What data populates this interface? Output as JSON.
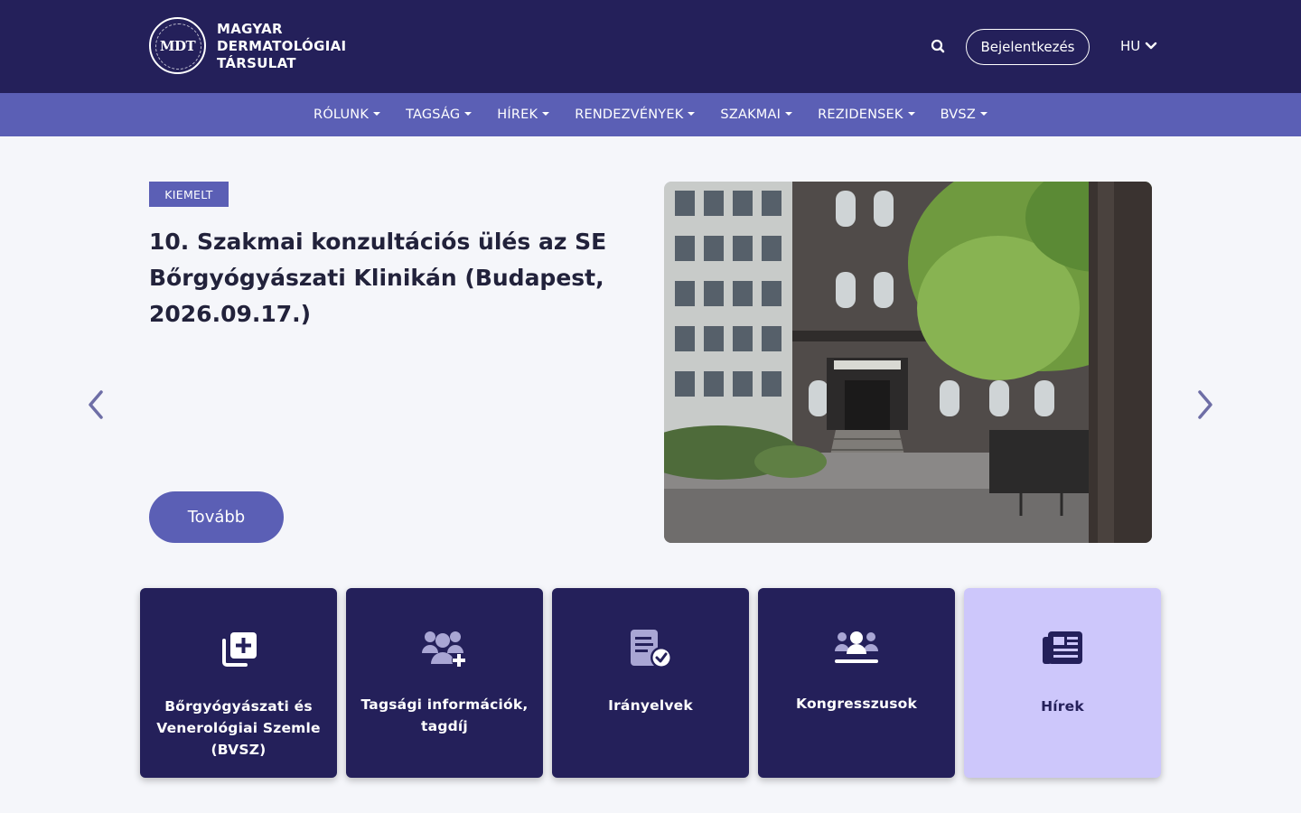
{
  "header": {
    "logo_mark": "MDT",
    "logo_lines": [
      "MAGYAR",
      "DERMATOLÓGIAI",
      "TÁRSULAT"
    ],
    "login_label": "Bejelentkezés",
    "language": "HU"
  },
  "nav": {
    "items": [
      "RÓLUNK",
      "TAGSÁG",
      "HÍREK",
      "RENDEZVÉNYEK",
      "SZAKMAI",
      "REZIDENSEK",
      "BVSZ"
    ]
  },
  "hero": {
    "badge": "KIEMELT",
    "title": "10. Szakmai konzultációs ülés az SE Bőrgyógyászati Klinikán (Budapest, 2026.09.17.)",
    "button_label": "Tovább"
  },
  "cards": [
    {
      "label": "Bőrgyógyászati és Venerológiai Szemle (BVSZ)",
      "icon": "journal-plus-icon"
    },
    {
      "label": "Tagsági információk, tagdíj",
      "icon": "users-plus-icon"
    },
    {
      "label": "Irányelvek",
      "icon": "document-check-icon"
    },
    {
      "label": "Kongresszusok",
      "icon": "people-group-icon"
    },
    {
      "label": "Hírek",
      "icon": "newspaper-icon"
    }
  ],
  "colors": {
    "header_bg": "#24205a",
    "nav_bg": "#5b5fb5",
    "accent": "#5b5fb5",
    "card_dark": "#24205a",
    "card_highlight": "#cdc7fb",
    "page_bg": "#f5f6fa"
  }
}
